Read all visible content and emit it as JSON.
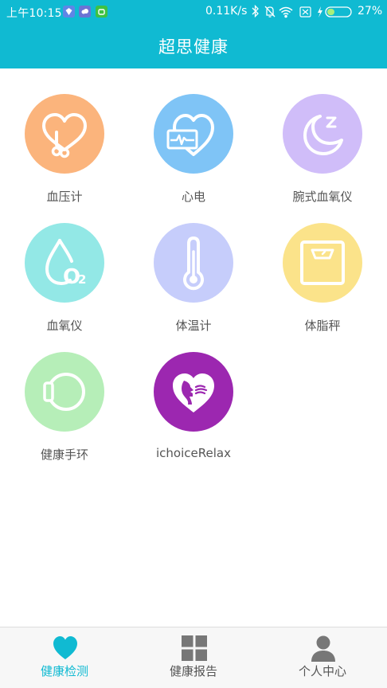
{
  "status_bar": {
    "time": "上午10:15",
    "network_speed": "0.11K/s",
    "battery_percent": "27%",
    "icons": [
      "bluetooth-icon",
      "mute-icon",
      "wifi-icon",
      "sim-x-icon",
      "battery-charging-icon"
    ]
  },
  "header": {
    "title": "超思健康"
  },
  "devices": [
    {
      "label": "血压计",
      "icon": "stethoscope-heart-icon",
      "color": "#fbb47c"
    },
    {
      "label": "心电",
      "icon": "ecg-heart-icon",
      "color": "#7fc4f6"
    },
    {
      "label": "腕式血氧仪",
      "icon": "moon-sleep-icon",
      "color": "#d0bdf9"
    },
    {
      "label": "血氧仪",
      "icon": "oxygen-drop-icon",
      "color": "#93e8e6"
    },
    {
      "label": "体温计",
      "icon": "thermometer-icon",
      "color": "#c6cdfb"
    },
    {
      "label": "体脂秤",
      "icon": "scale-icon",
      "color": "#fbe38a"
    },
    {
      "label": "健康手环",
      "icon": "wristband-icon",
      "color": "#b6eeb8"
    },
    {
      "label": "ichoiceRelax",
      "icon": "relax-heart-icon",
      "color": "#9c27b0"
    }
  ],
  "bottom_nav": {
    "tabs": [
      {
        "label": "健康检测",
        "icon": "heart-icon",
        "active": true
      },
      {
        "label": "健康报告",
        "icon": "grid-icon",
        "active": false
      },
      {
        "label": "个人中心",
        "icon": "person-icon",
        "active": false
      }
    ],
    "active_color": "#10bad2",
    "inactive_color": "#777777"
  }
}
